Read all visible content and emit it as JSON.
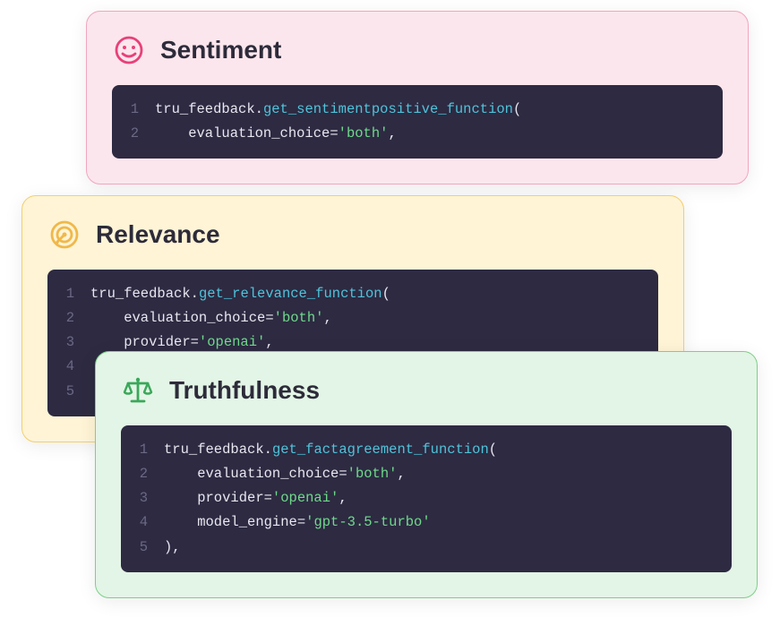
{
  "cards": [
    {
      "id": "sentiment",
      "title": "Sentiment",
      "icon": "smiley-icon",
      "icon_color": "#e8407a",
      "bg": "#fce6ed",
      "border": "#f2a6bd",
      "code": [
        [
          {
            "t": "base",
            "s": "tru_feedback"
          },
          {
            "t": "punc",
            "s": "."
          },
          {
            "t": "func",
            "s": "get_sentimentpositive_function"
          },
          {
            "t": "punc",
            "s": "("
          }
        ],
        [
          {
            "t": "base",
            "s": "    evaluation_choice="
          },
          {
            "t": "str",
            "s": "'both'"
          },
          {
            "t": "punc",
            "s": ","
          }
        ]
      ]
    },
    {
      "id": "relevance",
      "title": "Relevance",
      "icon": "target-icon",
      "icon_color": "#f0b84a",
      "bg": "#fff4d6",
      "border": "#f2cf6f",
      "code": [
        [
          {
            "t": "base",
            "s": "tru_feedback"
          },
          {
            "t": "punc",
            "s": "."
          },
          {
            "t": "func",
            "s": "get_relevance_function"
          },
          {
            "t": "punc",
            "s": "("
          }
        ],
        [
          {
            "t": "base",
            "s": "    evaluation_choice="
          },
          {
            "t": "str",
            "s": "'both'"
          },
          {
            "t": "punc",
            "s": ","
          }
        ],
        [
          {
            "t": "base",
            "s": "    provider="
          },
          {
            "t": "str",
            "s": "'openai'"
          },
          {
            "t": "punc",
            "s": ","
          }
        ],
        [],
        []
      ]
    },
    {
      "id": "truthfulness",
      "title": "Truthfulness",
      "icon": "scales-icon",
      "icon_color": "#3aa85a",
      "bg": "#e3f5e6",
      "border": "#7fce8a",
      "code": [
        [
          {
            "t": "base",
            "s": "tru_feedback"
          },
          {
            "t": "punc",
            "s": "."
          },
          {
            "t": "func",
            "s": "get_factagreement_function"
          },
          {
            "t": "punc",
            "s": "("
          }
        ],
        [
          {
            "t": "base",
            "s": "    evaluation_choice="
          },
          {
            "t": "str",
            "s": "'both'"
          },
          {
            "t": "punc",
            "s": ","
          }
        ],
        [
          {
            "t": "base",
            "s": "    provider="
          },
          {
            "t": "str",
            "s": "'openai'"
          },
          {
            "t": "punc",
            "s": ","
          }
        ],
        [
          {
            "t": "base",
            "s": "    model_engine="
          },
          {
            "t": "str",
            "s": "'gpt-3.5-turbo'"
          }
        ],
        [
          {
            "t": "punc",
            "s": "),"
          }
        ]
      ]
    }
  ]
}
